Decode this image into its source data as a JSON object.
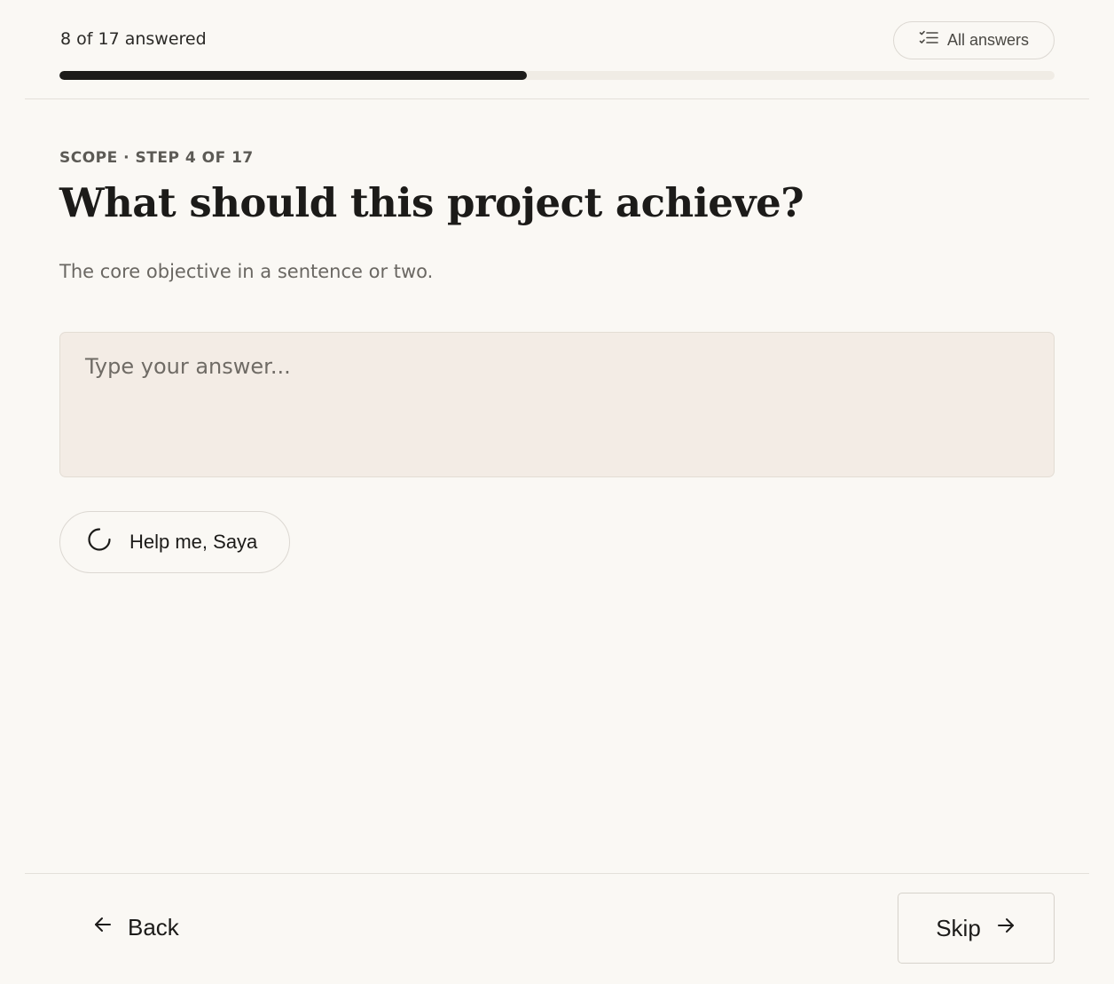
{
  "header": {
    "progress_label": "8 of 17 answered",
    "progress_fraction": 0.47,
    "all_answers_label": "All answers",
    "all_answers_icon": "checklist-icon"
  },
  "question": {
    "eyebrow": "SCOPE · STEP 4 OF 17",
    "title": "What should this project achieve?",
    "hint": "The core objective in a sentence or two.",
    "answer_value": "",
    "answer_placeholder": "Type your answer..."
  },
  "assistant": {
    "help_label": "Help me, Saya",
    "help_icon": "spinner-icon"
  },
  "footer": {
    "back_label": "Back",
    "back_icon": "arrow-left-icon",
    "skip_label": "Skip",
    "skip_icon": "arrow-right-icon"
  },
  "colors": {
    "background": "#faf8f4",
    "progress_fill": "#1c1b19",
    "progress_track": "#f0ece5",
    "answer_box": "#f3ece5"
  }
}
